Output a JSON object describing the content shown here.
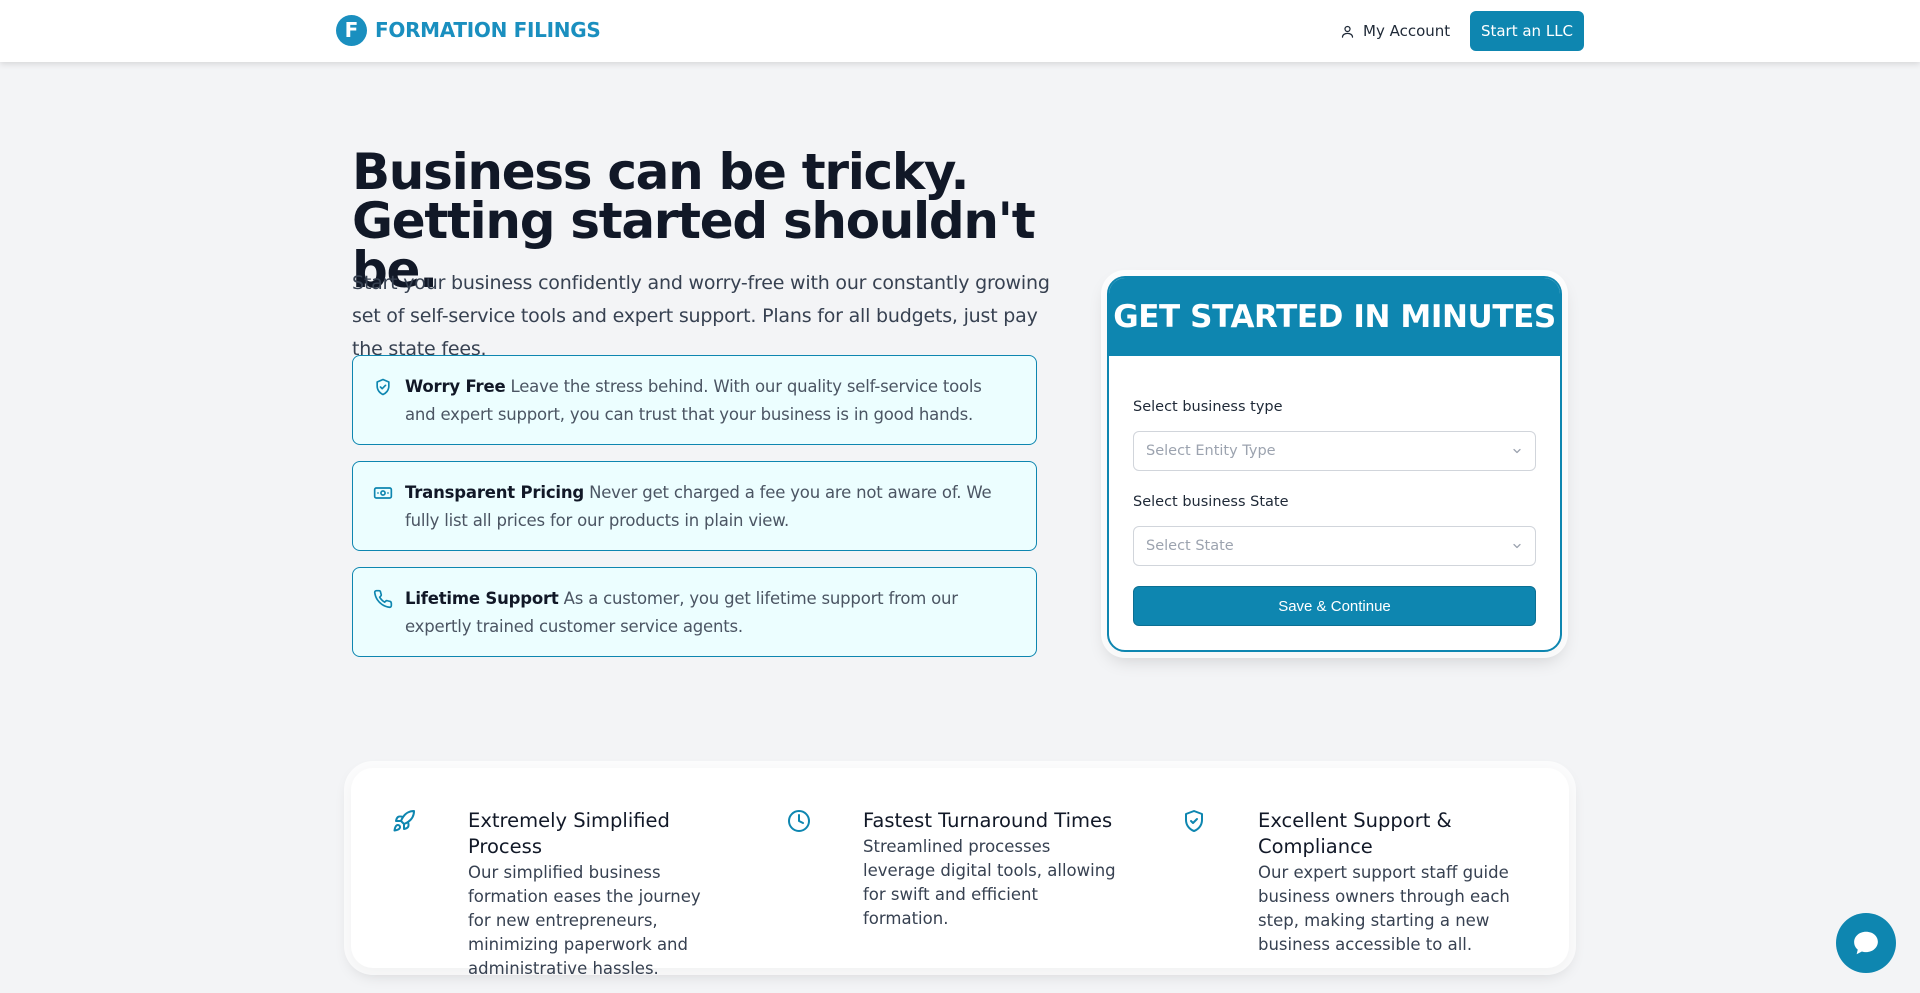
{
  "header": {
    "logo_mark": "F",
    "logo_text": "FORMATION FILINGS",
    "account_label": "My Account",
    "cta_label": "Start an LLC"
  },
  "hero": {
    "title_line1": "Business can be tricky.",
    "title_line2": "Getting started shouldn't be.",
    "subtitle": "Start your business confidently and worry-free with our constantly growing set of self-service tools and expert support. Plans for all budgets, just pay the state fees."
  },
  "features": [
    {
      "title": "Worry Free",
      "text": "Leave the stress behind. With our quality self-service tools and expert support, you can trust that your business is in good hands.",
      "icon": "shield-check-icon"
    },
    {
      "title": "Transparent Pricing",
      "text": "Never get charged a fee you are not aware of. We fully list all prices for our products in plain view.",
      "icon": "banknote-icon"
    },
    {
      "title": "Lifetime Support",
      "text": "As a customer, you get lifetime support from our expertly trained customer service agents.",
      "icon": "phone-icon"
    }
  ],
  "form": {
    "heading": "GET STARTED IN MINUTES",
    "type_label": "Select business type",
    "type_placeholder": "Select Entity Type",
    "state_label": "Select business State",
    "state_placeholder": "Select State",
    "submit_label": "Save & Continue"
  },
  "benefits": [
    {
      "title": "Extremely Simplified Process",
      "text": "Our simplified business formation eases the journey for new entrepreneurs, minimizing paperwork and administrative hassles.",
      "icon": "rocket-icon"
    },
    {
      "title": "Fastest Turnaround Times",
      "text": "Streamlined processes leverage digital tools, allowing for swift and efficient formation.",
      "icon": "clock-icon"
    },
    {
      "title": "Excellent Support & Compliance",
      "text": "Our expert support staff guide business owners through each step, making starting a new business accessible to all.",
      "icon": "shield-check-icon"
    }
  ],
  "colors": {
    "brand": "#0e86b0",
    "feature_bg": "#ecfeff",
    "page_bg": "#f3f4f6"
  }
}
